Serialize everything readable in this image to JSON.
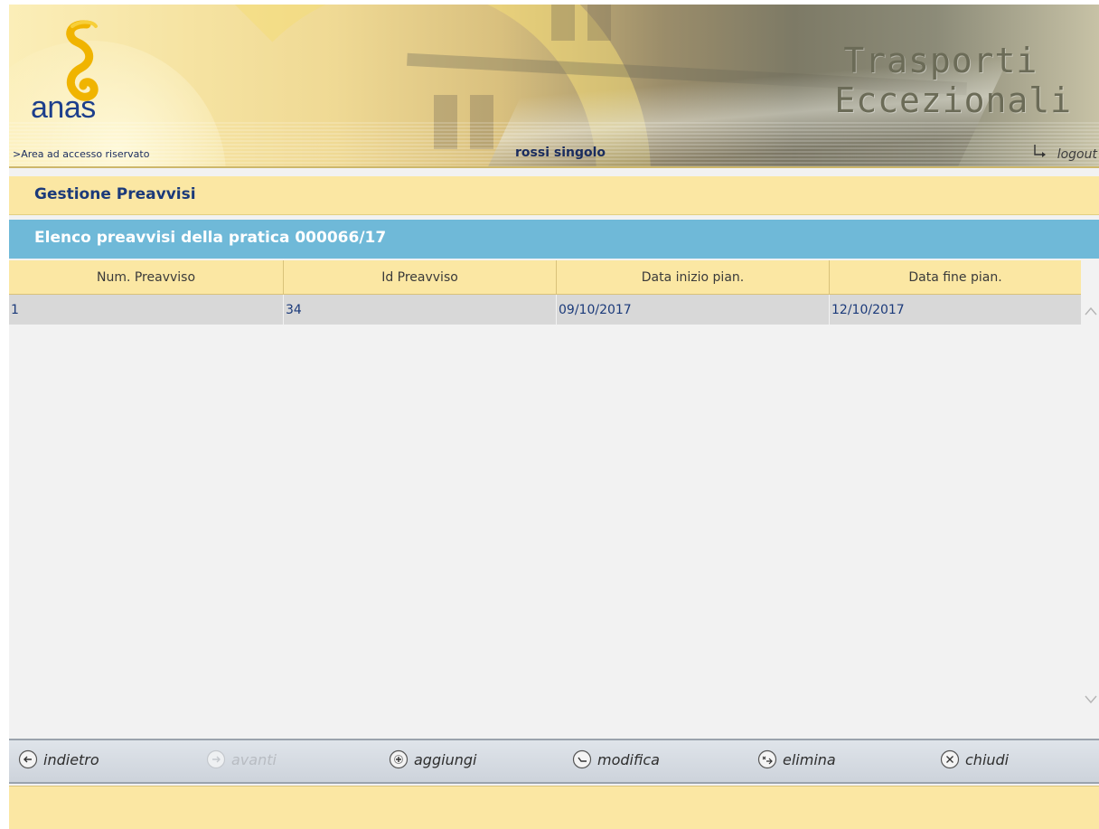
{
  "header": {
    "logo_text": "anas",
    "title_line1": "Trasporti",
    "title_line2": "Eccezionali",
    "area_link": ">Area ad accesso riservato",
    "user_name": "rossi singolo",
    "logout_label": "logout"
  },
  "section": {
    "title": "Gestione Preavvisi",
    "subtitle": "Elenco preavvisi della pratica 000066/17"
  },
  "table": {
    "columns": [
      "Num. Preavviso",
      "Id Preavviso",
      "Data inizio pian.",
      "Data fine pian."
    ],
    "rows": [
      [
        "1",
        "34",
        "09/10/2017",
        "12/10/2017"
      ]
    ]
  },
  "toolbar": {
    "back_label": "indietro",
    "forward_label": "avanti",
    "add_label": "aggiungi",
    "edit_label": "modifica",
    "delete_label": "elimina",
    "close_label": "chiudi"
  },
  "colors": {
    "brand_blue": "#1d3f8c",
    "section_bg": "#fbe7a3",
    "subtitle_bg": "#6fb9d8",
    "row_bg": "#d8d8d8"
  },
  "icons": [
    "anas-logo-icon",
    "logout-arrow-icon",
    "scroll-up-icon",
    "scroll-down-icon",
    "back-arrow-icon",
    "forward-arrow-icon",
    "add-icon",
    "edit-icon",
    "delete-icon",
    "close-icon"
  ]
}
